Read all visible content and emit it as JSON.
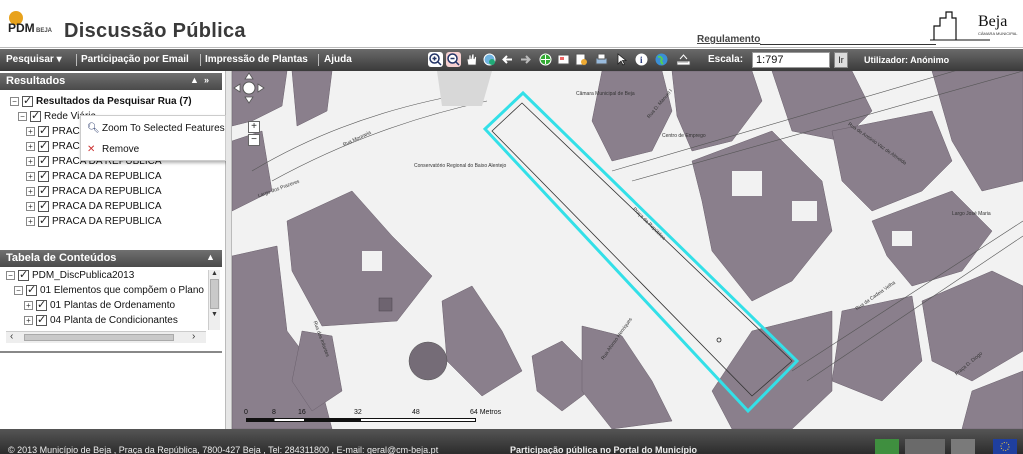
{
  "header": {
    "app_name": "Discussão Pública",
    "logo_text": "PDM",
    "logo_sub": "BEJA",
    "regulation_link": "Regulamento",
    "city_logo_text": "Beja",
    "city_logo_sub": "CÂMARA MUNICIPAL"
  },
  "toolbar": {
    "menu": [
      "Pesquisar",
      "Participação por Email",
      "Impressão de Plantas",
      "Ajuda"
    ],
    "menu_dropdown_icon": "chevron-down-icon",
    "tools": [
      "zoom-in-icon",
      "zoom-out-icon",
      "pan-hand-icon",
      "globe-refresh-icon",
      "arrow-back-icon",
      "arrow-forward-icon",
      "full-extent-icon",
      "layers-icon",
      "query-icon",
      "print-icon",
      "select-icon",
      "info-icon",
      "world-icon",
      "measure-icon"
    ],
    "scale_label": "Escala:",
    "scale_value": "1:797",
    "scale_go": "Ir",
    "user_label": "Utilizador: Anónimo"
  },
  "results_panel": {
    "title": "Resultados",
    "root": "Resultados da Pesquisar Rua (7)",
    "group": "Rede Viária",
    "items": [
      "PRACA",
      "PRACA",
      "PRACA DA REPUBLICA",
      "PRACA DA REPUBLICA",
      "PRACA DA REPUBLICA",
      "PRACA DA REPUBLICA",
      "PRACA DA REPUBLICA"
    ]
  },
  "context_menu": {
    "zoom_label": "Zoom To Selected Features",
    "remove_label": "Remove"
  },
  "toc_panel": {
    "title": "Tabela de Conteúdos",
    "root": "PDM_DiscPublica2013",
    "group": "01 Elementos que compõem o Plano",
    "items": [
      "01 Plantas de Ordenamento",
      "04 Planta de Condicionantes"
    ]
  },
  "map": {
    "labels": {
      "camara": "Câmara Municipal de Beja",
      "rua_manuel": "Rua D. Manuel I",
      "centro_emprego": "Centro de Emprego",
      "rua_alvito": "Rua de António Vaz de Almeida",
      "conservatorio": "Conservatório Regional do Baixo Alentejo",
      "rua_vigaria": "Rua Mouraria",
      "largo_prazeres": "Largo dos Prazeres",
      "praca": "Praça da República",
      "rua_cadeia": "Rua da Cadeia Velha",
      "rua_aires": "Rua Afonso Henriques",
      "rua_rouras": "Rua dos Infantes",
      "rua_bando": "Rua de Alcoba",
      "largo_jose": "Largo José Maria",
      "praca_diogo": "Praça D. Diogo"
    },
    "scale_ticks": [
      "0",
      "8",
      "16",
      "32",
      "48",
      "64 Metros"
    ]
  },
  "footer": {
    "copyright": "© 2013 Município de Beja , Praça da República, 7800-427 Beja , Tel: 284311800 , E-mail: geral@cm-beja.pt",
    "portal": "Participação pública no Portal do Município"
  },
  "colors": {
    "highlight": "#33e0e8",
    "building": "#8a7f8c",
    "toolbar": "#4a4a4a"
  }
}
